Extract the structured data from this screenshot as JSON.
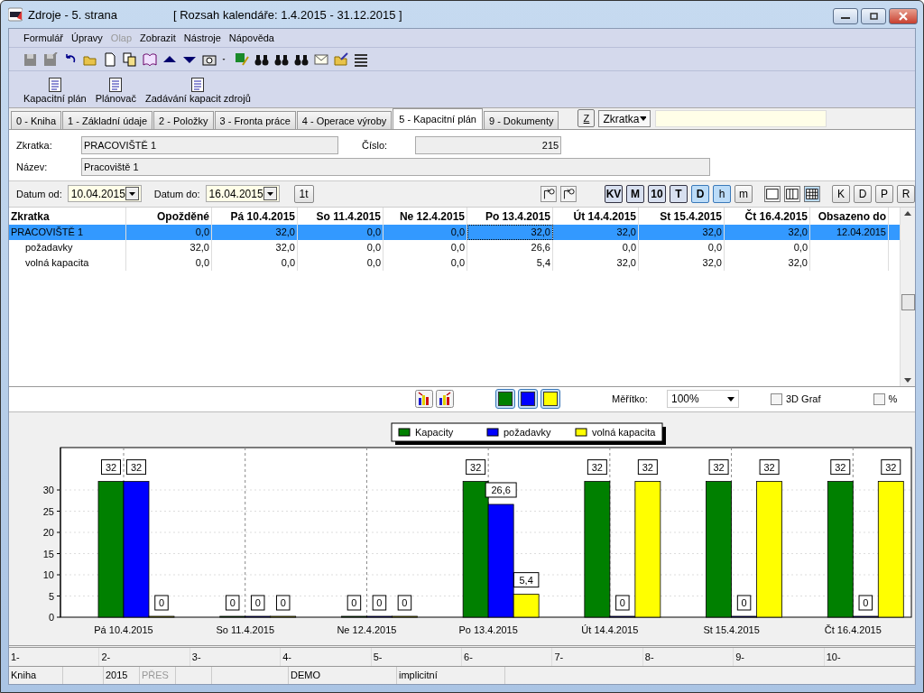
{
  "window": {
    "title": "Zdroje - 5. strana",
    "subtitle": "[ Rozsah kalendáře: 1.4.2015 - 31.12.2015 ]"
  },
  "menu": [
    {
      "label": "Formulář",
      "disabled": false
    },
    {
      "label": "Úpravy",
      "disabled": false
    },
    {
      "label": "Olap",
      "disabled": true
    },
    {
      "label": "Zobrazit",
      "disabled": false
    },
    {
      "label": "Nástroje",
      "disabled": false
    },
    {
      "label": "Nápověda",
      "disabled": false
    }
  ],
  "function_buttons": [
    "Kapacitní plán",
    "Plánovač",
    "Zadávání kapacit zdrojů"
  ],
  "tabs": [
    {
      "label": "0 - Kniha",
      "selected": false
    },
    {
      "label": "1 - Základní údaje",
      "selected": false
    },
    {
      "label": "2 - Položky",
      "selected": false
    },
    {
      "label": "3 - Fronta práce",
      "selected": false
    },
    {
      "label": "4 - Operace výroby",
      "selected": false
    },
    {
      "label": "5 - Kapacitní plán",
      "selected": true
    },
    {
      "label": "9 - Dokumenty",
      "selected": false
    }
  ],
  "search": {
    "button": "Z",
    "field_select": "Zkratka"
  },
  "form": {
    "zkratka_label": "Zkratka:",
    "zkratka": "PRACOVIŠTĚ 1",
    "cislo_label": "Číslo:",
    "cislo": "215",
    "nazev_label": "Název:",
    "nazev": "Pracoviště 1"
  },
  "dates": {
    "from_label": "Datum od:",
    "from": "10.04.2015",
    "to_label": "Datum do:",
    "to": "16.04.2015",
    "button": "1t"
  },
  "scale_buttons": [
    {
      "label": "KV",
      "selected": false
    },
    {
      "label": "M",
      "selected": false
    },
    {
      "label": "10",
      "selected": false
    },
    {
      "label": "T",
      "selected": false
    },
    {
      "label": "D",
      "selected": true
    },
    {
      "label": "h",
      "selected": true
    },
    {
      "label": "m",
      "selected": false
    }
  ],
  "view_buttons": [
    {
      "selected": false
    },
    {
      "selected": false
    },
    {
      "selected": true
    }
  ],
  "letter_buttons": [
    "K",
    "D",
    "P",
    "R"
  ],
  "table": {
    "columns": [
      "Zkratka",
      "Opožděné",
      "Pá 10.4.2015",
      "So 11.4.2015",
      "Ne 12.4.2015",
      "Po 13.4.2015",
      "Út 14.4.2015",
      "St 15.4.2015",
      "Čt 16.4.2015",
      "Obsazeno do"
    ],
    "rows": [
      {
        "selected": true,
        "cells": [
          "PRACOVIŠTĚ 1",
          "0,0",
          "32,0",
          "0,0",
          "0,0",
          "32,0",
          "32,0",
          "32,0",
          "32,0",
          "12.04.2015"
        ],
        "children": [
          {
            "selected": false,
            "cells": [
              "požadavky",
              "32,0",
              "32,0",
              "0,0",
              "0,0",
              "26,6",
              "0,0",
              "0,0",
              "0,0"
            ]
          },
          {
            "selected": false,
            "cells": [
              "volná kapacita",
              "0,0",
              "0,0",
              "0,0",
              "0,0",
              "5,4",
              "32,0",
              "32,0",
              "32,0"
            ]
          }
        ]
      }
    ]
  },
  "chart_toolbar": {
    "series_buttons": [
      {
        "color": "#008000"
      },
      {
        "color": "#0000ff"
      },
      {
        "color": "#ffff00"
      }
    ],
    "scale_label": "Měřítko:",
    "scale": "100%",
    "three_d": {
      "label": "3D Graf",
      "checked": false
    },
    "percent": {
      "label": "%",
      "checked": false
    }
  },
  "chart_data": {
    "type": "bar",
    "categories": [
      "Pá 10.4.2015",
      "So 11.4.2015",
      "Ne 12.4.2015",
      "Po 13.4.2015",
      "Út 14.4.2015",
      "St 15.4.2015",
      "Čt 16.4.2015"
    ],
    "series": [
      {
        "name": "Kapacity",
        "color": "#008000",
        "values": [
          32,
          0,
          0,
          32,
          32,
          32,
          32
        ],
        "value_labels": [
          "32",
          "0",
          "0",
          "32",
          "32",
          "32",
          "32"
        ]
      },
      {
        "name": "požadavky",
        "color": "#0000ff",
        "values": [
          32,
          0,
          0,
          26.6,
          0,
          0,
          0
        ],
        "value_labels": [
          "32",
          "0",
          "0",
          "26,6",
          "0",
          "0",
          "0"
        ]
      },
      {
        "name": "volná kapacita",
        "color": "#ffff00",
        "values": [
          0,
          0,
          0,
          5.4,
          32,
          32,
          32
        ],
        "value_labels": [
          "0",
          "0",
          "0",
          "5,4",
          "32",
          "32",
          "32"
        ]
      }
    ],
    "ylim": [
      0,
      40
    ],
    "yticks": [
      0,
      5,
      10,
      15,
      20,
      25,
      30
    ],
    "data_labels": true,
    "grid": true,
    "legend": true
  },
  "column_numbers": [
    "1-",
    "2-",
    "3-",
    "4-",
    "5-",
    "6-",
    "7-",
    "8-",
    "9-",
    "10-"
  ],
  "status_bar": [
    {
      "text": "Kniha",
      "disabled": false
    },
    {
      "text": "2015",
      "disabled": false
    },
    {
      "text": "PŘES",
      "disabled": true
    },
    {
      "text": "DEMO",
      "disabled": false
    },
    {
      "text": "implicitní",
      "disabled": false
    }
  ]
}
